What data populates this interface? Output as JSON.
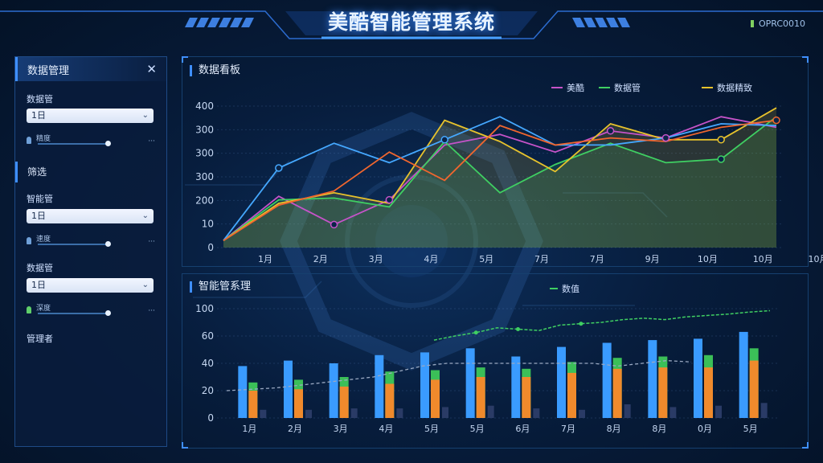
{
  "app": {
    "title": "美酷智能管理系统",
    "corner_label": "OPRC0010"
  },
  "sidebar": {
    "title": "数据管理",
    "fields": [
      {
        "label": "数据管",
        "select_value": "1日",
        "slider_label": "精度",
        "slider_value": 0.7
      },
      {
        "label": "智能管",
        "select_value": "1日",
        "slider_label": "速度",
        "slider_value": 0.7
      },
      {
        "label": "数据管",
        "select_value": "1日",
        "slider_label": "深度",
        "slider_value": 0.7
      }
    ],
    "section_label": "筛选",
    "footer_label": "管理者"
  },
  "colors": {
    "accent": "#3f8fff",
    "purple": "#c653c9",
    "green": "#3fcf62",
    "yellow": "#e7c22c",
    "blue": "#45a8ff",
    "orange": "#f0892e"
  },
  "chart_data": [
    {
      "type": "line",
      "title": "数据看板",
      "categories": [
        "1月",
        "2月",
        "3月",
        "4月",
        "5月",
        "7月",
        "7月",
        "9月",
        "10月",
        "10月",
        "10月"
      ],
      "ylim": [
        0,
        400
      ],
      "yticks": [
        "0",
        "10",
        "200",
        "300",
        "300",
        "300",
        "400"
      ],
      "legend": [
        "美酷",
        "数据管",
        "数据精致"
      ],
      "series": [
        {
          "name": "美酷",
          "color": "#c653c9",
          "values": [
            20,
            145,
            65,
            135,
            290,
            320,
            270,
            330,
            310,
            370,
            340
          ]
        },
        {
          "name": "数据管",
          "color": "#3fcf62",
          "values": [
            20,
            135,
            140,
            115,
            300,
            155,
            235,
            295,
            240,
            250,
            370
          ]
        },
        {
          "name": "数据精致",
          "color": "#e7c22c",
          "values": [
            20,
            125,
            155,
            125,
            360,
            300,
            215,
            350,
            305,
            305,
            395
          ]
        },
        {
          "color": "#45a8ff",
          "values": [
            20,
            225,
            295,
            240,
            305,
            370,
            290,
            290,
            310,
            350,
            345
          ]
        },
        {
          "color": "#f0662e",
          "values": [
            20,
            120,
            160,
            270,
            190,
            345,
            290,
            310,
            300,
            340,
            360
          ]
        }
      ]
    },
    {
      "type": "bar",
      "title": "智能管系理",
      "legend": [
        "数值"
      ],
      "categories": [
        "1月",
        "2月",
        "3月",
        "4月",
        "5月",
        "5月",
        "6月",
        "7月",
        "8月",
        "8月",
        "0月",
        "5月"
      ],
      "ylim": [
        0,
        100
      ],
      "yticks": [
        "0",
        "20",
        "40",
        "60",
        "100"
      ],
      "series": [
        {
          "name": "blue",
          "color": "#3a9bff",
          "values": [
            38,
            42,
            40,
            46,
            48,
            51,
            45,
            52,
            55,
            57,
            58,
            66
          ]
        },
        {
          "name": "green",
          "color": "#3bbf58",
          "values": [
            26,
            28,
            30,
            34,
            35,
            37,
            36,
            41,
            44,
            45,
            46,
            51
          ]
        },
        {
          "name": "orange",
          "color": "#f08a2c",
          "values": [
            20,
            21,
            23,
            25,
            28,
            30,
            30,
            33,
            36,
            37,
            37,
            42
          ]
        },
        {
          "name": "dark",
          "color": "#2a3b66",
          "values": [
            6,
            6,
            7,
            7,
            8,
            9,
            7,
            6,
            10,
            8,
            9,
            11
          ]
        }
      ],
      "line_green": [
        null,
        null,
        null,
        null,
        null,
        57,
        60,
        65,
        72,
        70,
        68,
        76,
        78,
        80,
        84,
        86,
        84,
        88,
        90,
        92,
        95,
        97
      ],
      "line_gray": [
        20,
        21,
        22,
        24,
        26,
        28,
        30,
        34,
        38,
        40,
        40,
        40,
        40,
        40,
        40,
        40,
        38,
        40,
        42,
        41
      ]
    }
  ]
}
